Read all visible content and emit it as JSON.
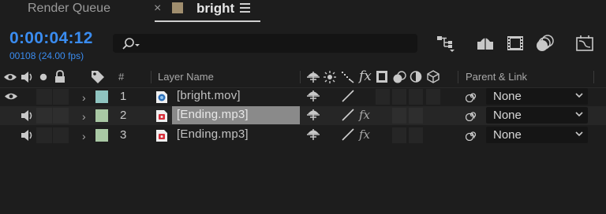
{
  "tabs": {
    "render_queue": "Render Queue",
    "close_symbol": "×",
    "composition": "bright",
    "composition_color": "#a08e6e"
  },
  "time": {
    "timecode": "0:00:04:12",
    "frames": "00108 (24.00 fps)"
  },
  "search": {
    "placeholder": ""
  },
  "columns": {
    "number": "#",
    "layer_name": "Layer Name",
    "fx": "fx",
    "parent": "Parent & Link"
  },
  "layers": [
    {
      "number": "1",
      "name": "[bright.mov]",
      "label_color": "#8fc4c0",
      "type": "video",
      "parent": "None",
      "has_fx": false,
      "selected": false
    },
    {
      "number": "2",
      "name": "[Ending.mp3]",
      "label_color": "#a9c8a4",
      "type": "audio",
      "parent": "None",
      "has_fx": true,
      "selected": true
    },
    {
      "number": "3",
      "name": "[Ending.mp3]",
      "label_color": "#a9c8a4",
      "type": "audio",
      "parent": "None",
      "has_fx": true,
      "selected": false
    }
  ],
  "colors": {
    "accent": "#3a8cf0",
    "background": "#1d1d1d"
  }
}
